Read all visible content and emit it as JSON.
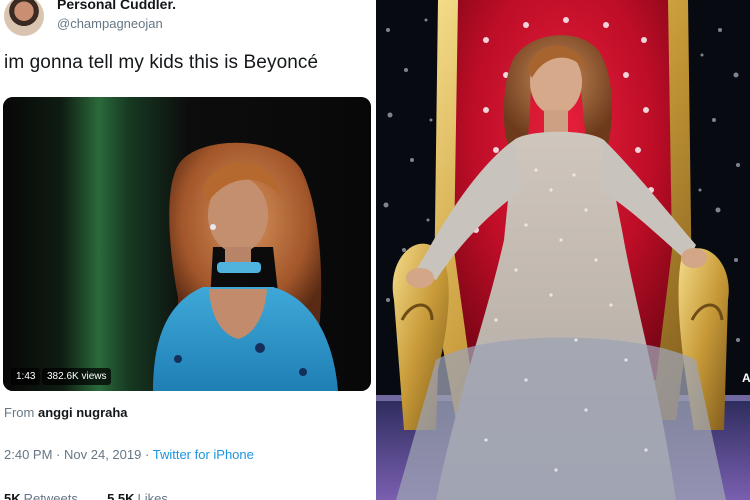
{
  "tweet": {
    "display_name": "Personal Cuddler.",
    "handle": "@champagneojan",
    "text": "im gonna tell my kids this is Beyoncé",
    "video": {
      "duration": "1:43",
      "views": "382.6K views"
    },
    "from_prefix": "From",
    "from_name": "anggi nugraha",
    "time": "2:40 PM",
    "separator": "·",
    "date": "Nov 24, 2019",
    "source": "Twitter for iPhone",
    "retweets_count": "5K",
    "retweets_label": "Retweets",
    "likes_count": "5.5K",
    "likes_label": "Likes",
    "colors": {
      "text": "#14171a",
      "secondary": "#657786",
      "link": "#1b95e0"
    }
  },
  "photo": {
    "watermark": "A"
  }
}
